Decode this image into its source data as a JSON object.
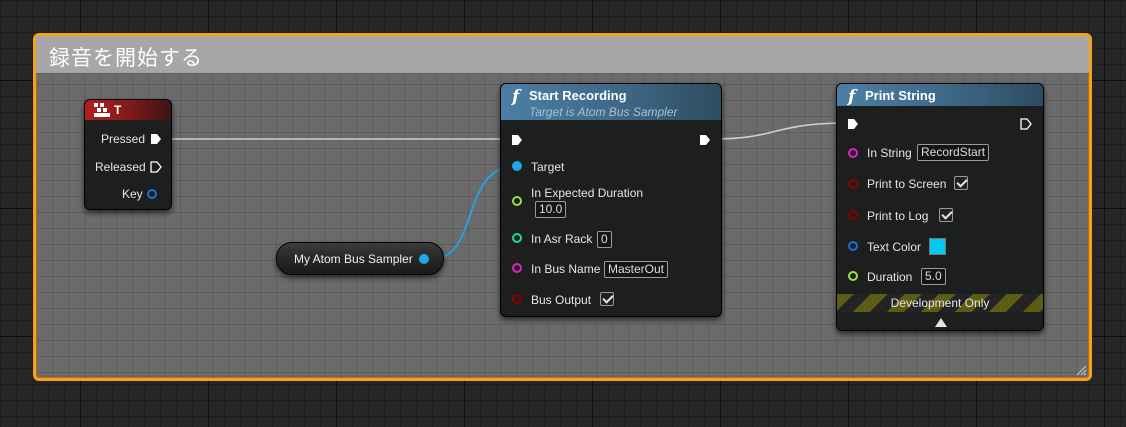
{
  "comment": {
    "title": "録音を開始する",
    "color": "#f4a21c"
  },
  "key_node": {
    "title": "T",
    "pins": {
      "pressed": "Pressed",
      "released": "Released",
      "key": "Key"
    }
  },
  "variable_node": {
    "label": "My Atom Bus Sampler"
  },
  "start_recording": {
    "title": "Start Recording",
    "subtitle": "Target is Atom Bus Sampler",
    "target": "Target",
    "expected_duration": {
      "label": "In Expected Duration",
      "value": "10.0"
    },
    "asr_rack": {
      "label": "In Asr Rack",
      "value": "0"
    },
    "bus_name": {
      "label": "In Bus Name",
      "value": "MasterOut"
    },
    "bus_output": {
      "label": "Bus Output",
      "checked": true
    }
  },
  "print_string": {
    "title": "Print String",
    "in_string": {
      "label": "In String",
      "value": "RecordStart"
    },
    "print_to_screen": {
      "label": "Print to Screen",
      "checked": true
    },
    "print_to_log": {
      "label": "Print to Log",
      "checked": true
    },
    "text_color": {
      "label": "Text Color",
      "value": "#00c8f0"
    },
    "duration": {
      "label": "Duration",
      "value": "5.0"
    },
    "footer": "Development Only"
  },
  "pin_colors": {
    "exec": "#ffffff",
    "object": "#1fa6e8",
    "float": "#9fe040",
    "int": "#1fd6a8",
    "string": "#e020c8",
    "bool": "#8a0000",
    "struct": "#1f6fd6"
  }
}
